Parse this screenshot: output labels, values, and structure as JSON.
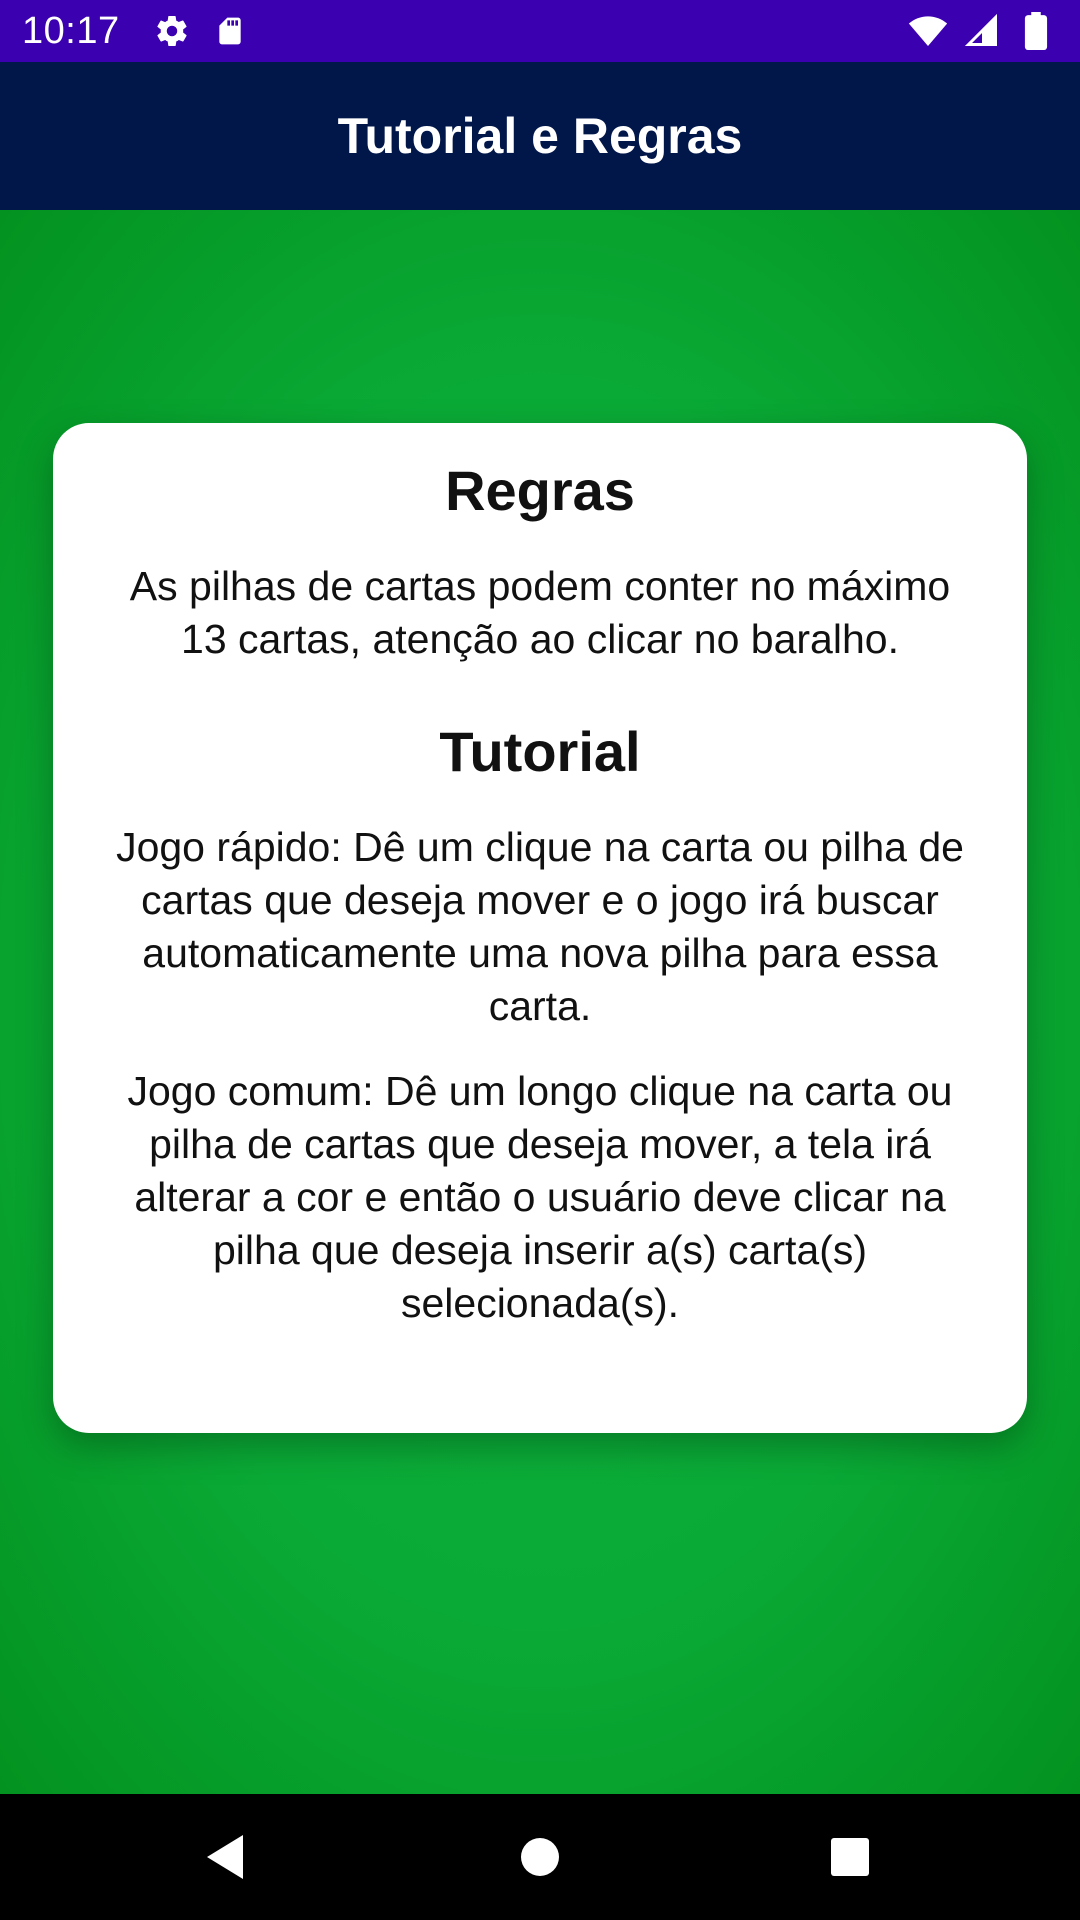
{
  "status_bar": {
    "time": "10:17",
    "icons_left": [
      "gear-icon",
      "sd-card-icon"
    ],
    "icons_right": [
      "wifi-icon",
      "signal-icon",
      "battery-icon"
    ],
    "background": "#3b00b0"
  },
  "app_bar": {
    "title": "Tutorial e Regras",
    "background": "#011649"
  },
  "card": {
    "rules_title": "Regras",
    "rules_text": "As pilhas de cartas podem conter no máximo 13 cartas, atenção ao clicar no baralho.",
    "tutorial_title": "Tutorial",
    "tutorial_text_1": "Jogo rápido: Dê um clique na carta ou pilha de cartas que deseja mover e o jogo irá buscar automaticamente uma nova pilha para essa carta.",
    "tutorial_text_2": "Jogo comum: Dê um longo clique na carta ou pilha de cartas que deseja mover, a tela irá alterar a cor e então o usuário deve clicar na pilha que deseja inserir a(s) carta(s) selecionada(s)."
  },
  "colors": {
    "content_background": "#0aaa36",
    "card_background": "#ffffff"
  },
  "nav_bar": {
    "buttons": [
      "back-icon",
      "home-icon",
      "recents-icon"
    ]
  }
}
